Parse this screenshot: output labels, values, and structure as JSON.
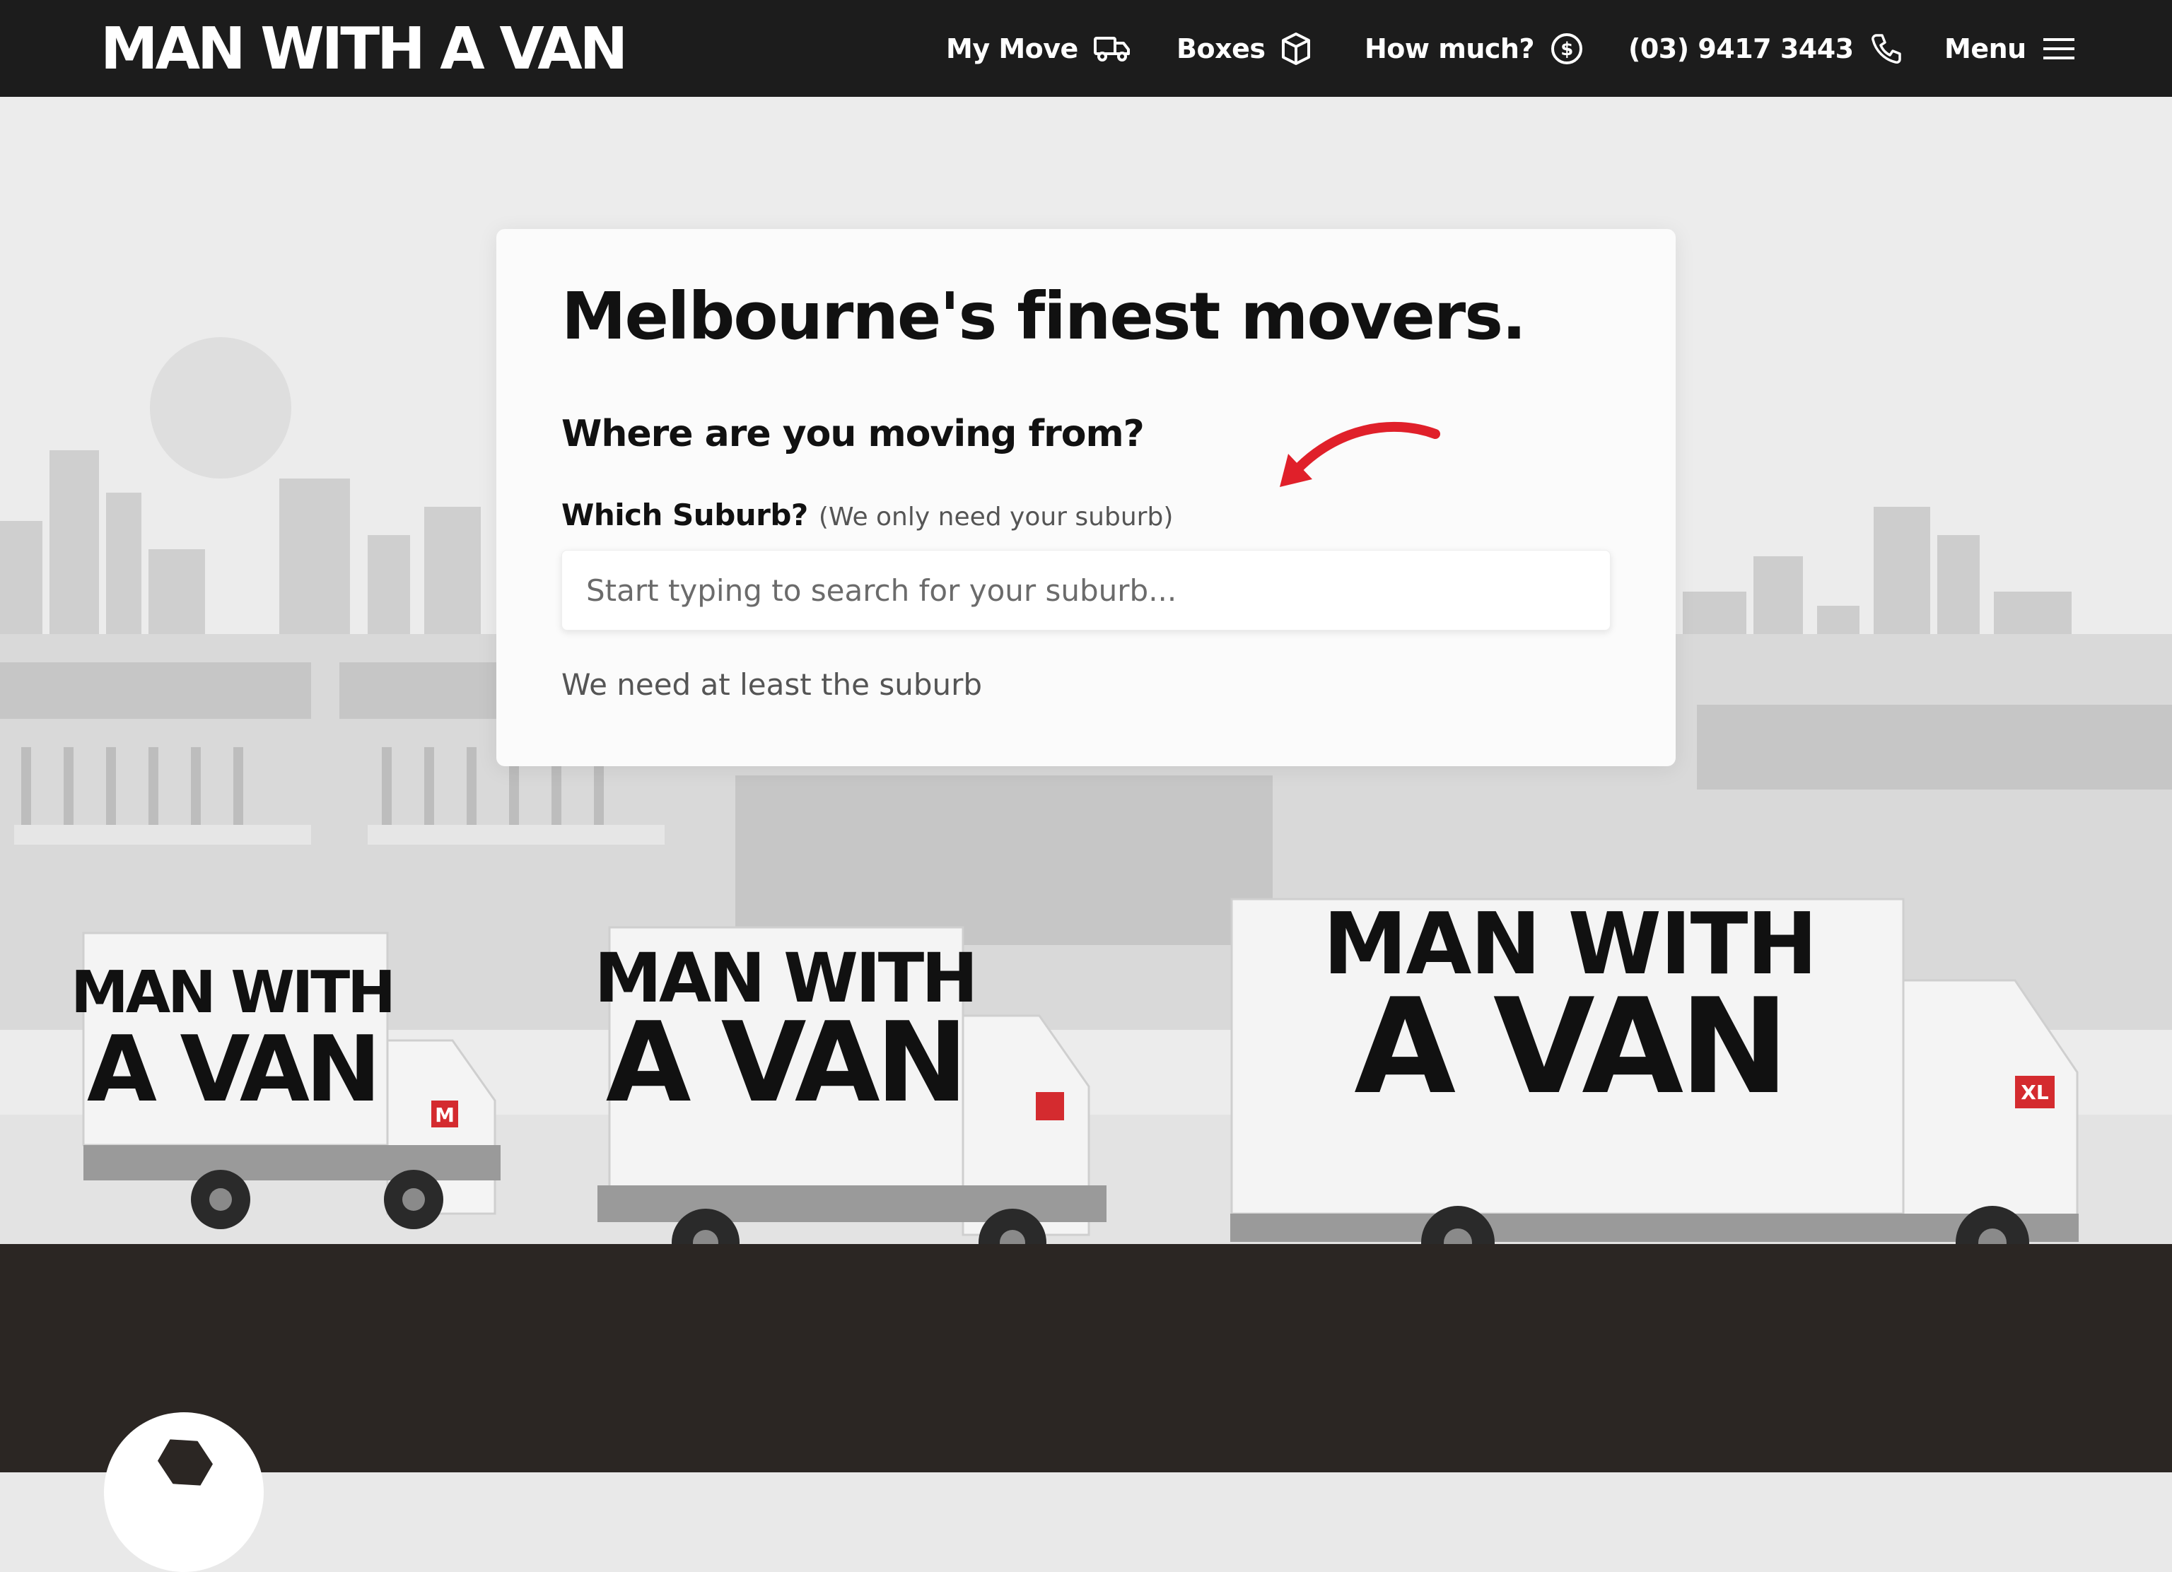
{
  "brand": {
    "logo_text": "MAN WITH A VAN"
  },
  "nav": {
    "my_move": "My Move",
    "boxes": "Boxes",
    "how_much": "How much?",
    "phone": "(03) 9417 3443",
    "menu": "Menu"
  },
  "hero": {
    "title": "Melbourne's finest movers.",
    "subtitle": "Where are you moving from?",
    "field_label": "Which Suburb?",
    "field_hint": "(We only need your suburb)",
    "input_placeholder": "Start typing to search for your suburb...",
    "input_value": "",
    "validation": "We need at least the suburb",
    "van_small_line1": "MAN WITH",
    "van_small_line2": "A VAN",
    "van_medium_line1": "MAN WITH",
    "van_medium_line2": "A VAN",
    "van_large_line1": "MAN WITH",
    "van_large_line2": "A VAN",
    "van_small_badge": "M",
    "van_large_badge": "XL"
  },
  "colors": {
    "nav_bg": "#1c1c1c",
    "hero_bg": "#ececec",
    "accent_red": "#e0202a",
    "footer_bg": "#2b2623"
  },
  "icons": {
    "my_move": "truck-icon",
    "boxes": "box-icon",
    "how_much": "dollar-circle-icon",
    "phone": "phone-icon",
    "menu": "hamburger-icon"
  }
}
